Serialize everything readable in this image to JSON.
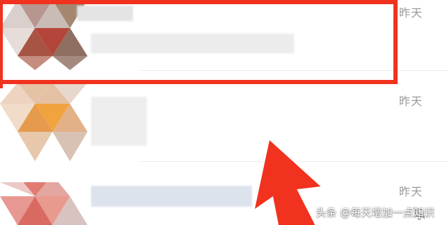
{
  "list": {
    "items": [
      {
        "time": "昨天",
        "muted": false
      },
      {
        "time": "昨天",
        "muted": true
      },
      {
        "time": "昨天",
        "muted": false
      }
    ]
  },
  "icons": {
    "mute": "bell-off-icon",
    "arrow": "up-arrow-annotation"
  },
  "colors": {
    "highlight": "#f0321e",
    "time_text": "#9a9a9a"
  },
  "watermark": "头条 @每天增加一点知识"
}
